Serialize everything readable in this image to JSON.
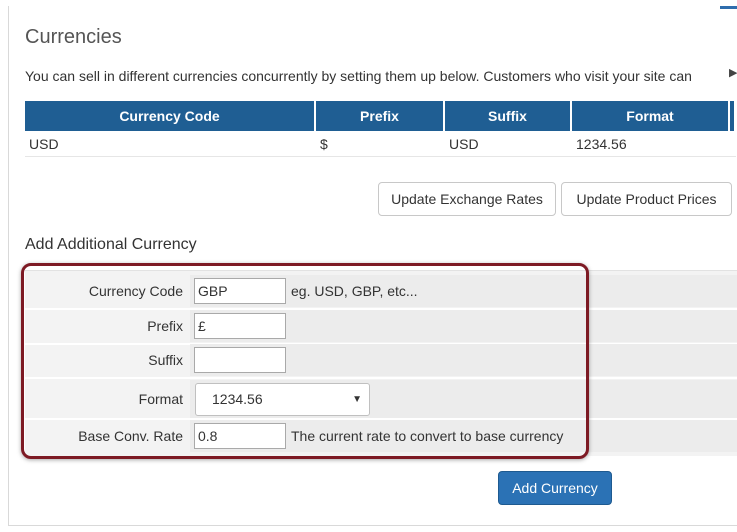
{
  "page": {
    "title": "Currencies",
    "intro": "You can sell in different currencies concurrently by setting them up below. Customers who visit your site can"
  },
  "currency_table": {
    "columns": [
      "Currency Code",
      "Prefix",
      "Suffix",
      "Format"
    ],
    "rows": [
      {
        "code": "USD",
        "prefix": "$",
        "suffix": "USD",
        "format": "1234.56"
      }
    ]
  },
  "actions": {
    "update_exchange_rates": "Update Exchange Rates",
    "update_product_prices": "Update Product Prices"
  },
  "add_form": {
    "section_title": "Add Additional Currency",
    "fields": {
      "currency_code": {
        "label": "Currency Code",
        "value": "GBP",
        "hint": "eg. USD, GBP, etc..."
      },
      "prefix": {
        "label": "Prefix",
        "value": "£"
      },
      "suffix": {
        "label": "Suffix",
        "value": ""
      },
      "format": {
        "label": "Format",
        "value": "1234.56"
      },
      "base_conv_rate": {
        "label": "Base Conv. Rate",
        "value": "0.8",
        "hint": "The current rate to convert to base currency"
      }
    },
    "submit_label": "Add Currency"
  },
  "colors": {
    "table_header": "#1f5e93",
    "primary_button": "#2b72b5",
    "highlight_border": "#7d1a24"
  },
  "icons": {
    "select_arrow": "chevron-down-icon",
    "scroll_arrow": "scroll-right-icon"
  }
}
